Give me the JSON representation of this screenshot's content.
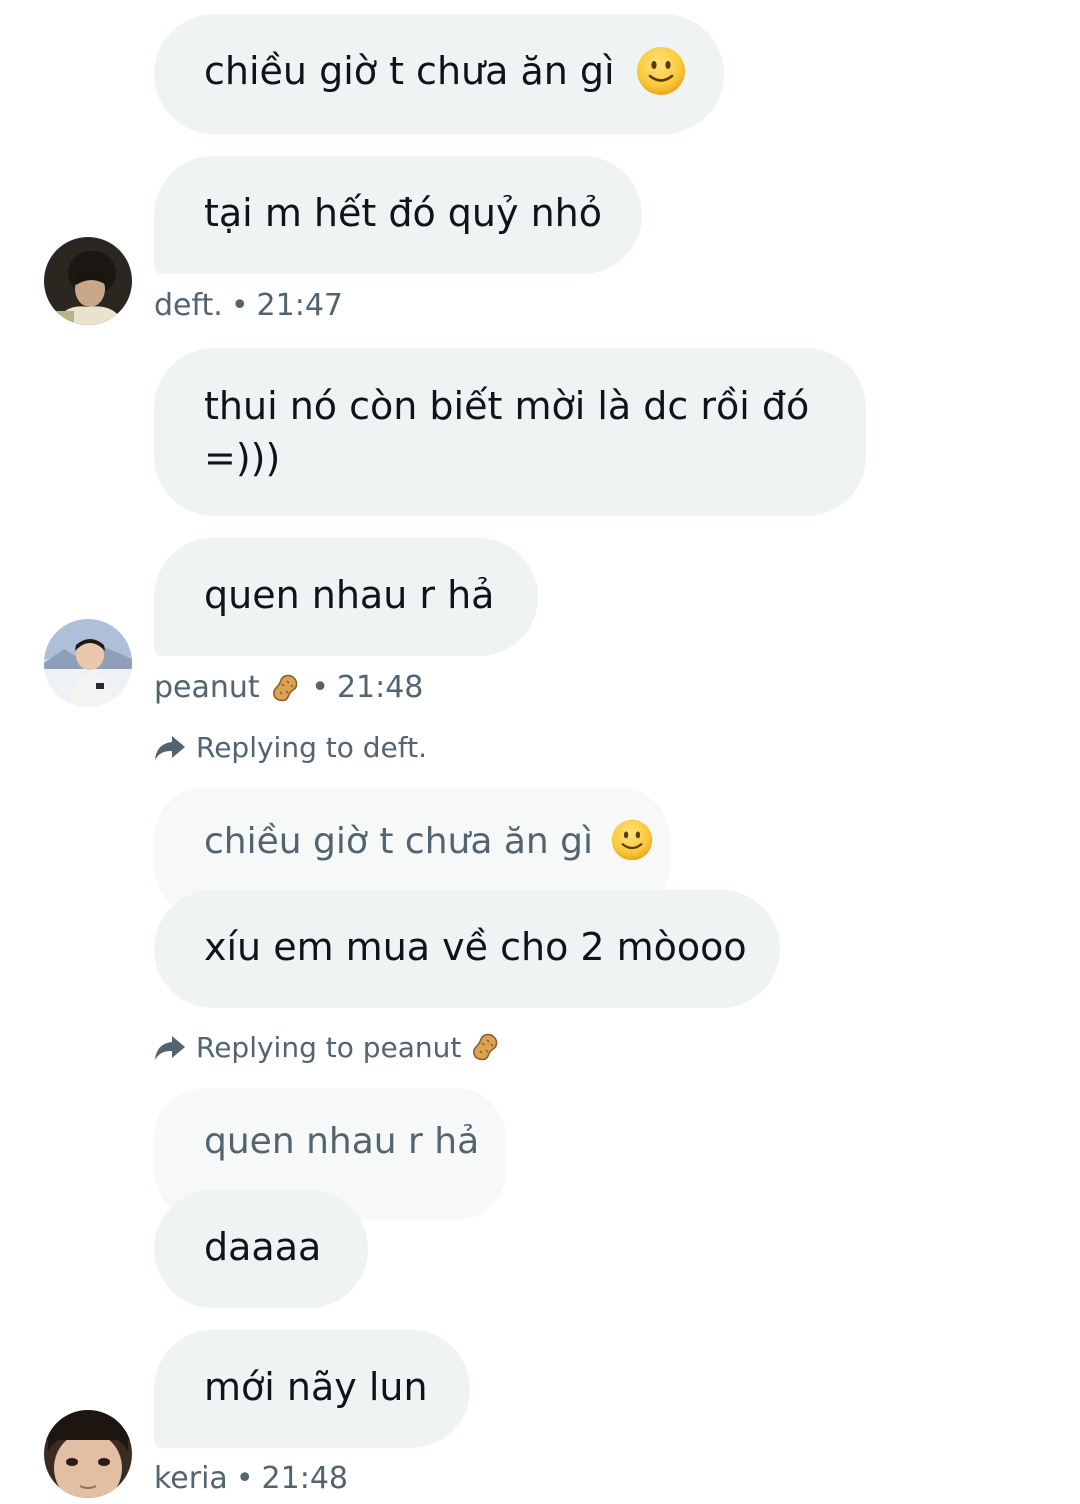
{
  "messages": [
    {
      "text": "chiều giờ t chưa ăn gì",
      "emoji": "slightly-smiling-face"
    },
    {
      "text": "tại m hết đó quỷ nhỏ"
    },
    {
      "text": "thui nó còn biết mời là dc rồi đó =)))"
    },
    {
      "text": "quen nhau r hả"
    },
    {
      "text": "xíu em mua về cho 2 mòooo"
    },
    {
      "text": "daaaa"
    },
    {
      "text": "mới nãy lun"
    }
  ],
  "senders": [
    {
      "name": "deft.",
      "time": "21:47",
      "avatar": "deft-avatar"
    },
    {
      "name": "peanut",
      "time": "21:48",
      "avatar": "peanut-avatar",
      "badge": "peanut-emoji"
    },
    {
      "name": "keria",
      "time": "21:48",
      "avatar": "keria-avatar"
    }
  ],
  "separator": "•",
  "replies": [
    {
      "label": "Replying to deft.",
      "quoted": "chiều giờ t chưa ăn gì",
      "quoted_emoji": "slightly-smiling-face"
    },
    {
      "label": "Replying to peanut",
      "label_emoji": "peanut-emoji",
      "quoted": "quen nhau r hả"
    }
  ],
  "colors": {
    "bubble": "#eff3f4",
    "quote_bubble": "#f7f9f9",
    "text": "#0f1419",
    "secondary_text": "#536471",
    "background": "#ffffff"
  }
}
